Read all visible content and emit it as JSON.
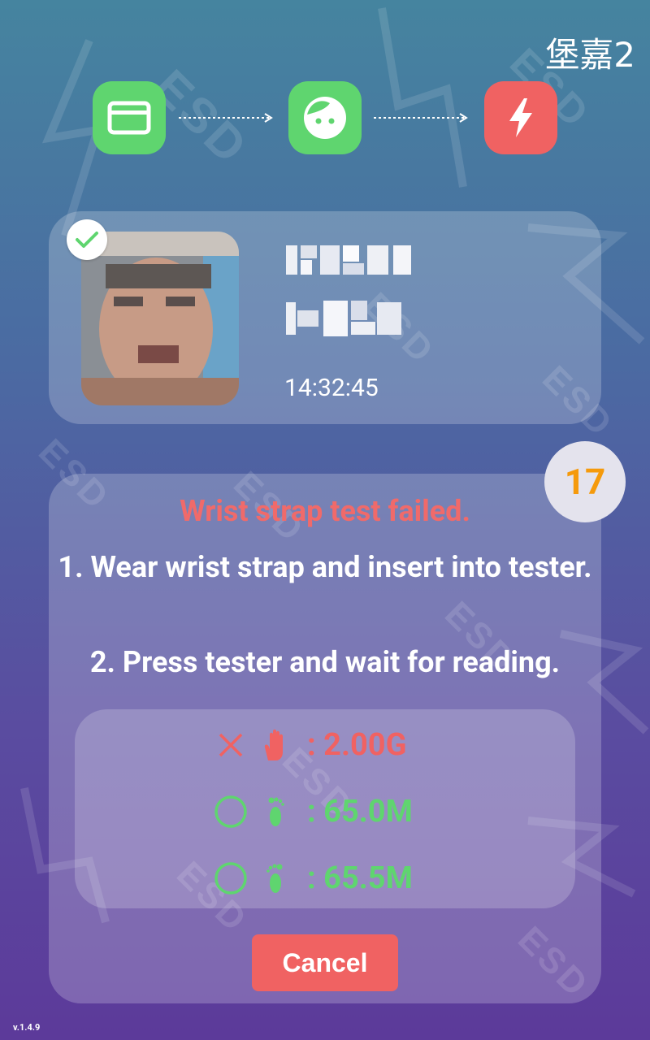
{
  "device_name": "堡嘉2",
  "steps": [
    {
      "icon": "card-icon",
      "color": "#5fd56f"
    },
    {
      "icon": "face-icon",
      "color": "#5fd56f"
    },
    {
      "icon": "lightning-icon",
      "color": "#f06262"
    }
  ],
  "watermark_text": "ESD",
  "employee": {
    "verified_icon": "check-icon",
    "time": "14:32:45"
  },
  "countdown": "17",
  "test": {
    "status_message": "Wrist strap test failed.",
    "instructions": [
      "1. Wear wrist strap and insert into tester.",
      "2. Press tester and wait for reading."
    ],
    "readings": [
      {
        "status": "fail",
        "status_icon": "cross-icon",
        "limb_icon": "hand-icon",
        "value": ": 2.00G",
        "color": "#f06262"
      },
      {
        "status": "pass",
        "status_icon": "circle-icon",
        "limb_icon": "left-foot-icon",
        "value": ": 65.0M",
        "color": "#5fd56f"
      },
      {
        "status": "pass",
        "status_icon": "circle-icon",
        "limb_icon": "right-foot-icon",
        "value": ": 65.5M",
        "color": "#5fd56f"
      }
    ]
  },
  "cancel_label": "Cancel",
  "version": "v.1.4.9"
}
